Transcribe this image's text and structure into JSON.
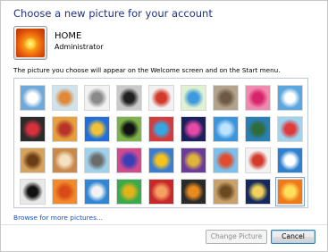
{
  "dialog": {
    "heading": "Choose a new picture for your account"
  },
  "account": {
    "name": "HOME",
    "role": "Administrator"
  },
  "description": "The picture you choose will appear on the Welcome screen and on the Start menu.",
  "pictures": [
    {
      "name": "picture-blue-circles",
      "bg": "#6fa9d8",
      "accent": "#ffffff",
      "selected": false
    },
    {
      "name": "picture-starfish",
      "bg": "#cfe3ef",
      "accent": "#e0893a",
      "selected": false
    },
    {
      "name": "picture-robot",
      "bg": "#f2f2f2",
      "accent": "#8a8a8a",
      "selected": false
    },
    {
      "name": "picture-vinyl-record",
      "bg": "#c9c9c9",
      "accent": "#202020",
      "selected": false
    },
    {
      "name": "picture-lucky-cat",
      "bg": "#f1f1f1",
      "accent": "#d33a2c",
      "selected": false
    },
    {
      "name": "picture-globe",
      "bg": "#dff1d0",
      "accent": "#3c9adf",
      "selected": false
    },
    {
      "name": "picture-kitten",
      "bg": "#b3a38d",
      "accent": "#6e5a44",
      "selected": false
    },
    {
      "name": "picture-pink-flower",
      "bg": "#f08ab0",
      "accent": "#d9246b",
      "selected": false
    },
    {
      "name": "picture-ferris-wheel",
      "bg": "#5aa6df",
      "accent": "#ffffff",
      "selected": false
    },
    {
      "name": "picture-swirl-ball",
      "bg": "#2b2b2b",
      "accent": "#d8313c",
      "selected": false
    },
    {
      "name": "picture-colored-blocks",
      "bg": "#e6a13c",
      "accent": "#b8342b",
      "selected": false
    },
    {
      "name": "picture-guitar-pick",
      "bg": "#1f6fd8",
      "accent": "#f0c23a",
      "selected": false
    },
    {
      "name": "picture-dogs",
      "bg": "#7bb24a",
      "accent": "#111111",
      "selected": false
    },
    {
      "name": "picture-crayons",
      "bg": "#d33c3c",
      "accent": "#34a7e3",
      "selected": false
    },
    {
      "name": "picture-fireworks",
      "bg": "#1b1f5e",
      "accent": "#e64aa7",
      "selected": false
    },
    {
      "name": "picture-bubbles",
      "bg": "#3a95dc",
      "accent": "#bde3ff",
      "selected": false
    },
    {
      "name": "picture-mountain-lake",
      "bg": "#2a7fb4",
      "accent": "#2f6c3a",
      "selected": false
    },
    {
      "name": "picture-paper-crane",
      "bg": "#9fd3f0",
      "accent": "#e03a3a",
      "selected": false
    },
    {
      "name": "picture-acoustic-guitar",
      "bg": "#d6a35e",
      "accent": "#6b3d15",
      "selected": false
    },
    {
      "name": "picture-puppy",
      "bg": "#c8894a",
      "accent": "#f4e0c2",
      "selected": false
    },
    {
      "name": "picture-toy-robot",
      "bg": "#9fd2ea",
      "accent": "#6b6b6b",
      "selected": false
    },
    {
      "name": "picture-fabric",
      "bg": "#d24a8e",
      "accent": "#3b3fb6",
      "selected": false
    },
    {
      "name": "picture-sunflower",
      "bg": "#3a7ccf",
      "accent": "#f6c21d",
      "selected": false
    },
    {
      "name": "picture-beetle",
      "bg": "#6b3b9a",
      "accent": "#e0b33b",
      "selected": false
    },
    {
      "name": "picture-hot-air-balloon",
      "bg": "#7ac0ea",
      "accent": "#e24b2b",
      "selected": false
    },
    {
      "name": "picture-nesting-doll",
      "bg": "#f2f2f2",
      "accent": "#d33a2c",
      "selected": false
    },
    {
      "name": "picture-sailboat",
      "bg": "#2f7fd0",
      "accent": "#ffffff",
      "selected": false
    },
    {
      "name": "picture-soccer-ball",
      "bg": "#e8e8e8",
      "accent": "#111111",
      "selected": false
    },
    {
      "name": "picture-orange-fabric",
      "bg": "#f08a2a",
      "accent": "#d94a18",
      "selected": false
    },
    {
      "name": "picture-ocean-rock",
      "bg": "#2e86d4",
      "accent": "#f2f2f2",
      "selected": false
    },
    {
      "name": "picture-green-window",
      "bg": "#3aaa4a",
      "accent": "#e2b21a",
      "selected": false
    },
    {
      "name": "picture-red-pattern",
      "bg": "#c8282a",
      "accent": "#f4a060",
      "selected": false
    },
    {
      "name": "picture-butterfly",
      "bg": "#2a2a2a",
      "accent": "#e88a1e",
      "selected": false
    },
    {
      "name": "picture-spiral-shell",
      "bg": "#c8a06a",
      "accent": "#6b4a22",
      "selected": false
    },
    {
      "name": "picture-night-lighthouse",
      "bg": "#142a5c",
      "accent": "#f2d25a",
      "selected": false
    },
    {
      "name": "picture-orange-flower",
      "bg": "#f07a1a",
      "accent": "#ffe05a",
      "selected": true
    }
  ],
  "links": {
    "browse": "Browse for more pictures..."
  },
  "buttons": {
    "change_picture": "Change Picture",
    "cancel": "Cancel"
  }
}
